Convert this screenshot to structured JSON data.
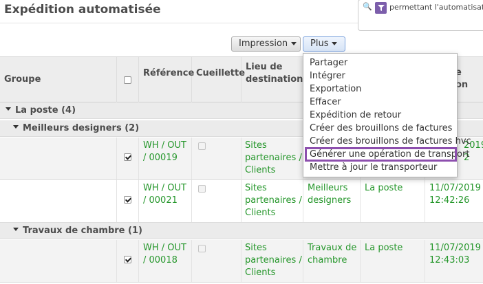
{
  "page": {
    "title": "Expédition automatisée"
  },
  "search": {
    "facet_text": "permettant l'automatisation"
  },
  "toolbar": {
    "print_label": "Impression",
    "more_label": "Plus"
  },
  "table": {
    "headers": {
      "group": "Groupe",
      "reference": "Référence",
      "picking": "Cueillette",
      "destination_line1": "Lieu de",
      "destination_line2": "destination",
      "col6_hidden_line1": "e",
      "col6_hidden_line2": "on"
    },
    "groups": [
      {
        "label": "La poste (4)"
      },
      {
        "label": "Meilleurs designers (2)"
      },
      {
        "label": "Travaux de chambre (1)"
      }
    ],
    "rows": [
      {
        "ref_line1": "WH / OUT",
        "ref_line2": "/ 00019",
        "dest_line1": "Sites",
        "dest_line2": "partenaires /",
        "dest_line3": "Clients",
        "date_line1": "2019",
        "date_line2": "2",
        "checked": true
      },
      {
        "ref_line1": "WH / OUT",
        "ref_line2": "/ 00021",
        "dest_line1": "Sites",
        "dest_line2": "partenaires /",
        "dest_line3": "Clients",
        "partner_line1": "Meilleurs",
        "partner_line2": "designers",
        "carrier": "La poste",
        "date_line1": "11/07/2019",
        "date_line2": "12:42:26",
        "checked": true
      },
      {
        "ref_line1": "WH / OUT",
        "ref_line2": "/ 00018",
        "dest_line1": "Sites",
        "dest_line2": "partenaires /",
        "dest_line3": "Clients",
        "partner_line1": "Travaux de",
        "partner_line2": "chambre",
        "carrier": "La poste",
        "date_line1": "11/07/2019",
        "date_line2": "12:43:03",
        "checked": true
      }
    ]
  },
  "more_menu": {
    "items": [
      "Partager",
      "Intégrer",
      "Exportation",
      "Effacer",
      "Expédition de retour",
      "Créer des brouillons de factures",
      "Créer des brouillons de factures hvc",
      "Générer une opération de transport",
      "Mettre à jour le transporteur"
    ],
    "highlighted_index": 7,
    "highlight_color": "#8d4fae"
  },
  "colors": {
    "link_green": "#24962a",
    "facet_purple": "#7c5eab"
  }
}
